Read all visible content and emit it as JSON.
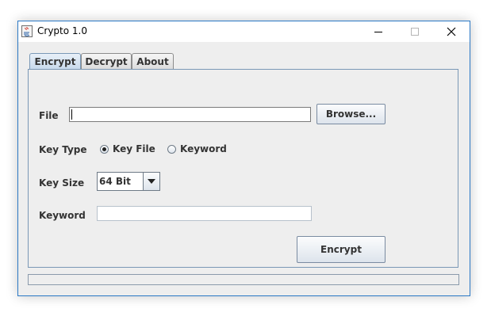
{
  "window": {
    "title": "Crypto 1.0"
  },
  "tabs": [
    {
      "label": "Encrypt",
      "active": true
    },
    {
      "label": "Decrypt",
      "active": false
    },
    {
      "label": "About",
      "active": false
    }
  ],
  "form": {
    "file_label": "File",
    "file_value": "",
    "browse_label": "Browse...",
    "key_type_label": "Key Type",
    "key_type_options": [
      {
        "label": "Key File",
        "selected": true
      },
      {
        "label": "Keyword",
        "selected": false
      }
    ],
    "key_size_label": "Key Size",
    "key_size_value": "64 Bit",
    "keyword_label": "Keyword",
    "keyword_value": "",
    "encrypt_button_label": "Encrypt"
  },
  "progress": {
    "value": 0
  },
  "colors": {
    "window_border": "#2b79c6",
    "panel_border": "#7a98b6",
    "background": "#eeeeee"
  }
}
